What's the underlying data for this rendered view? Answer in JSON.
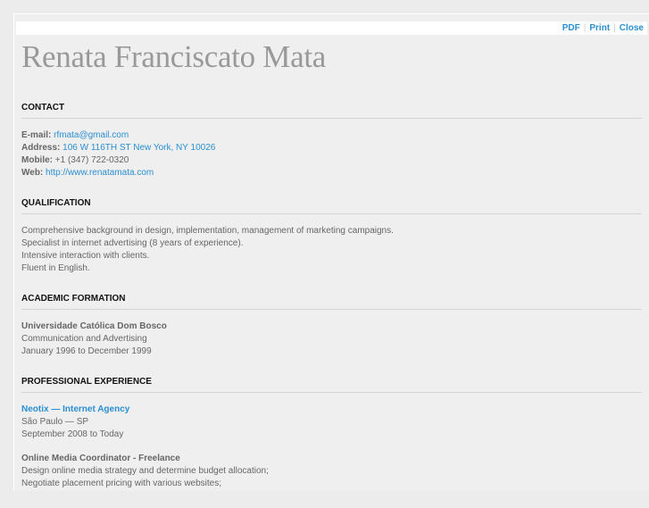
{
  "toolbar": {
    "pdf": "PDF",
    "print": "Print",
    "close": "Close",
    "separator": "|"
  },
  "name": "Renata Franciscato Mata",
  "contact": {
    "heading": "CONTACT",
    "email_label": "E-mail:",
    "email": "rfmata@gmail.com",
    "address_label": "Address:",
    "address": "106 W 116TH ST New York, NY 10026",
    "mobile_label": "Mobile:",
    "mobile": "+1 (347) 722-0320",
    "web_label": "Web:",
    "web": "http://www.renatamata.com"
  },
  "qualification": {
    "heading": "QUALIFICATION",
    "lines": [
      "Comprehensive background in design, implementation, management of marketing campaigns.",
      "Specialist in internet advertising (8 years of experience).",
      "Intensive interaction with clients.",
      "Fluent in English."
    ]
  },
  "academic": {
    "heading": "ACADEMIC FORMATION",
    "school": "Universidade Católica Dom Bosco",
    "course": "Communication and Advertising",
    "period": "January 1996 to December 1999"
  },
  "experience": {
    "heading": "PROFESSIONAL EXPERIENCE",
    "company": "Neotix — Internet Agency",
    "location": "São Paulo — SP",
    "period": "September 2008 to Today",
    "role": "Online Media Coordinator - Freelance",
    "duties": [
      "Design online media strategy and determine budget allocation;",
      "Negotiate placement pricing with various websites;"
    ]
  }
}
